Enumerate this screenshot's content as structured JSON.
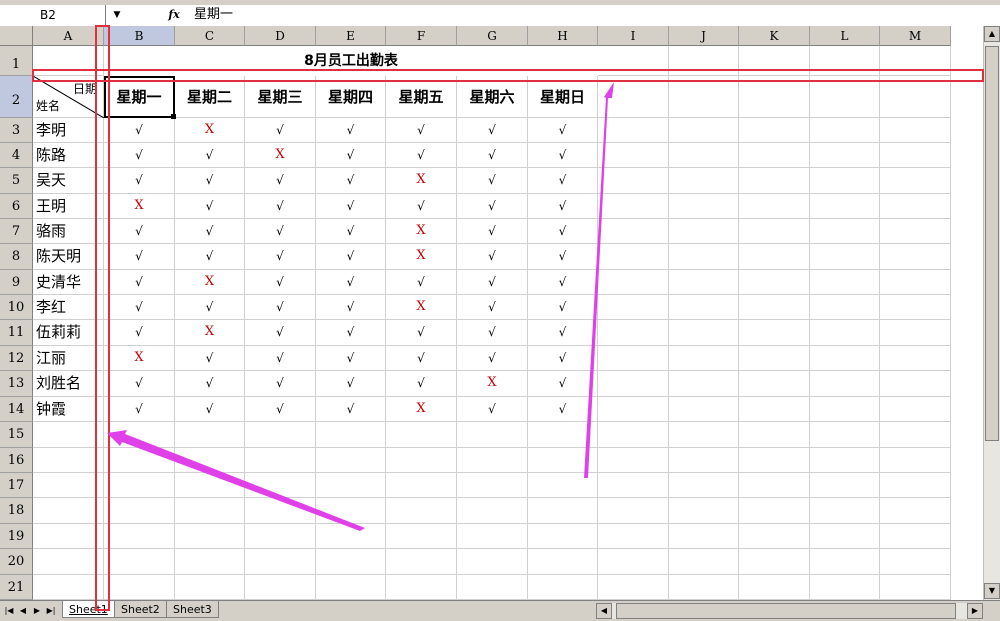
{
  "formula_bar": {
    "cell_ref": "B2",
    "fx_label": "fx",
    "content": "星期一"
  },
  "columns": [
    "A",
    "B",
    "C",
    "D",
    "E",
    "F",
    "G",
    "H",
    "I",
    "J",
    "K",
    "L",
    "M"
  ],
  "rows": [
    "1",
    "2",
    "3",
    "4",
    "5",
    "6",
    "7",
    "8",
    "9",
    "10",
    "11",
    "12",
    "13",
    "14",
    "15",
    "16",
    "17",
    "18",
    "19",
    "20",
    "21"
  ],
  "sheet": {
    "title": "8月员工出勤表",
    "corner_date_label": "日期",
    "corner_name_label": "姓名",
    "days": [
      "星期一",
      "星期二",
      "星期三",
      "星期四",
      "星期五",
      "星期六",
      "星期日"
    ],
    "employees": [
      {
        "name": "李明",
        "marks": [
          "√",
          "X",
          "√",
          "√",
          "√",
          "√",
          "√"
        ]
      },
      {
        "name": "陈路",
        "marks": [
          "√",
          "√",
          "X",
          "√",
          "√",
          "√",
          "√"
        ]
      },
      {
        "name": "吴天",
        "marks": [
          "√",
          "√",
          "√",
          "√",
          "X",
          "√",
          "√"
        ]
      },
      {
        "name": "王明",
        "marks": [
          "X",
          "√",
          "√",
          "√",
          "√",
          "√",
          "√"
        ]
      },
      {
        "name": "骆雨",
        "marks": [
          "√",
          "√",
          "√",
          "√",
          "X",
          "√",
          "√"
        ]
      },
      {
        "name": "陈天明",
        "marks": [
          "√",
          "√",
          "√",
          "√",
          "X",
          "√",
          "√"
        ]
      },
      {
        "name": "史清华",
        "marks": [
          "√",
          "X",
          "√",
          "√",
          "√",
          "√",
          "√"
        ]
      },
      {
        "name": "李红",
        "marks": [
          "√",
          "√",
          "√",
          "√",
          "X",
          "√",
          "√"
        ]
      },
      {
        "name": "伍莉莉",
        "marks": [
          "√",
          "X",
          "√",
          "√",
          "√",
          "√",
          "√"
        ]
      },
      {
        "name": "江丽",
        "marks": [
          "X",
          "√",
          "√",
          "√",
          "√",
          "√",
          "√"
        ]
      },
      {
        "name": "刘胜名",
        "marks": [
          "√",
          "√",
          "√",
          "√",
          "√",
          "X",
          "√"
        ]
      },
      {
        "name": "钟霞",
        "marks": [
          "√",
          "√",
          "√",
          "√",
          "X",
          "√",
          "√"
        ]
      }
    ]
  },
  "tabs": [
    "Sheet1",
    "Sheet2",
    "Sheet3"
  ],
  "active_tab": "Sheet1",
  "colors": {
    "absent_mark": "#c00000",
    "annotation_box": "#e03040",
    "annotation_arrow": "#e040e8"
  }
}
